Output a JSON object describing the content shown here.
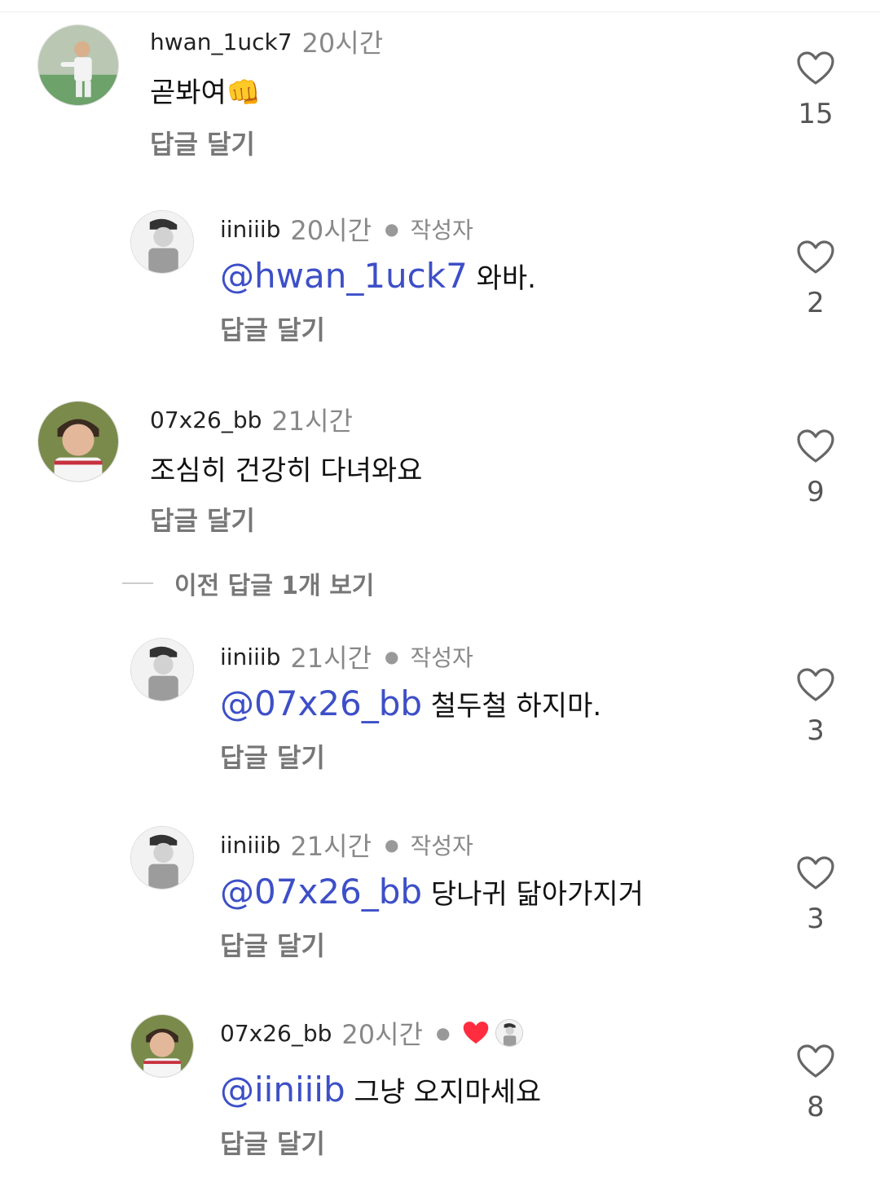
{
  "comments": [
    {
      "user": "hwan_1uck7",
      "time": "20시간",
      "text": "곧봐여",
      "emoji": "👊",
      "reply": "답글 달기",
      "likes": "15"
    },
    {
      "user": "iiniiib",
      "time": "20시간",
      "author_tag": "작성자",
      "mention": "@hwan_1uck7",
      "text": "와바.",
      "reply": "답글 달기",
      "likes": "2"
    },
    {
      "user": "07x26_bb",
      "time": "21시간",
      "text": "조심히 건강히 다녀와요",
      "reply": "답글 달기",
      "likes": "9"
    },
    {
      "user": "iiniiib",
      "time": "21시간",
      "author_tag": "작성자",
      "mention": "@07x26_bb",
      "text": "철두철 하지마.",
      "reply": "답글 달기",
      "likes": "3"
    },
    {
      "user": "iiniiib",
      "time": "21시간",
      "author_tag": "작성자",
      "mention": "@07x26_bb",
      "text": "당나귀 닮아가지거",
      "reply": "답글 달기",
      "likes": "3"
    },
    {
      "user": "07x26_bb",
      "time": "20시간",
      "mention": "@iiniiib",
      "text": "그냥 오지마세요",
      "reply": "답글 달기",
      "likes": "8"
    }
  ],
  "view_previous": "이전 답글 1개 보기",
  "colors": {
    "mention": "#3d4fc7",
    "heart_liked": "#ff2d3f"
  },
  "icons": {
    "like": "heart-outline-icon",
    "liked_by_author": "heart-filled-icon"
  }
}
